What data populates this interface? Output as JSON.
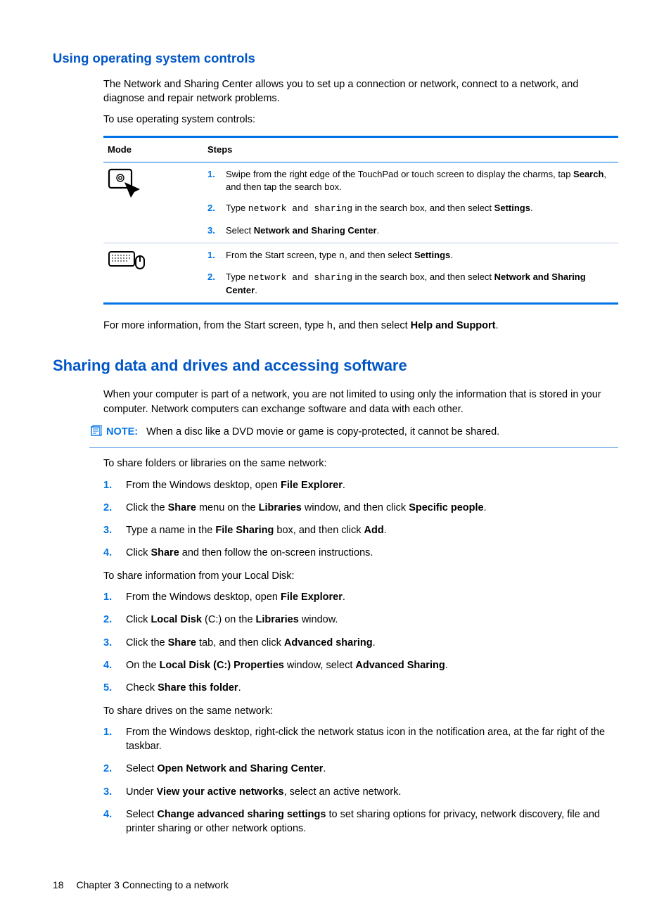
{
  "section1": {
    "title": "Using operating system controls",
    "intro": "The Network and Sharing Center allows you to set up a connection or network, connect to a network, and diagnose and repair network problems.",
    "lead": "To use operating system controls:",
    "table": {
      "h1": "Mode",
      "h2": "Steps",
      "row1": {
        "s1a": "Swipe from the right edge of the TouchPad or touch screen to display the charms, tap ",
        "s1b": "Search",
        "s1c": ", and then tap the search box.",
        "s2a": "Type ",
        "s2mono": "network and sharing",
        "s2b": " in the search box, and then select ",
        "s2c": "Settings",
        "s2d": ".",
        "s3a": "Select ",
        "s3b": "Network and Sharing Center",
        "s3c": "."
      },
      "row2": {
        "s1a": "From the Start screen, type ",
        "s1mono": "n",
        "s1b": ", and then select ",
        "s1c": "Settings",
        "s1d": ".",
        "s2a": "Type ",
        "s2mono": "network and sharing",
        "s2b": " in the search box, and then select ",
        "s2c": "Network and Sharing Center",
        "s2d": "."
      }
    },
    "after_a": "For more information, from the Start screen, type ",
    "after_mono": "h",
    "after_b": ", and then select ",
    "after_c": "Help and Support",
    "after_d": "."
  },
  "section2": {
    "title": "Sharing data and drives and accessing software",
    "intro": "When your computer is part of a network, you are not limited to using only the information that is stored in your computer. Network computers can exchange software and data with each other.",
    "note_label": "NOTE:",
    "note_text": "When a disc like a DVD movie or game is copy-protected, it cannot be shared.",
    "lead1": "To share folders or libraries on the same network:",
    "list1": {
      "s1a": "From the Windows desktop, open ",
      "s1b": "File Explorer",
      "s1c": ".",
      "s2a": "Click the ",
      "s2b": "Share",
      "s2c": " menu on the ",
      "s2d": "Libraries",
      "s2e": " window, and then click ",
      "s2f": "Specific people",
      "s2g": ".",
      "s3a": "Type a name in the ",
      "s3b": "File Sharing",
      "s3c": " box, and then click ",
      "s3d": "Add",
      "s3e": ".",
      "s4a": "Click ",
      "s4b": "Share",
      "s4c": " and then follow the on-screen instructions."
    },
    "lead2": "To share information from your Local Disk:",
    "list2": {
      "s1a": "From the Windows desktop, open ",
      "s1b": "File Explorer",
      "s1c": ".",
      "s2a": "Click ",
      "s2b": "Local Disk",
      "s2c": " (C:) on the ",
      "s2d": "Libraries",
      "s2e": " window.",
      "s3a": "Click the ",
      "s3b": "Share",
      "s3c": " tab, and then click ",
      "s3d": "Advanced sharing",
      "s3e": ".",
      "s4a": "On the ",
      "s4b": "Local Disk (C:) Properties",
      "s4c": " window, select ",
      "s4d": "Advanced Sharing",
      "s4e": ".",
      "s5a": "Check ",
      "s5b": "Share this folder",
      "s5c": "."
    },
    "lead3": "To share drives on the same network:",
    "list3": {
      "s1": "From the Windows desktop, right-click the network status icon in the notification area, at the far right of the taskbar.",
      "s2a": "Select ",
      "s2b": "Open Network and Sharing Center",
      "s2c": ".",
      "s3a": "Under ",
      "s3b": "View your active networks",
      "s3c": ", select an active network.",
      "s4a": "Select ",
      "s4b": "Change advanced sharing settings",
      "s4c": " to set sharing options for privacy, network discovery, file and printer sharing or other network options."
    }
  },
  "footer": {
    "page": "18",
    "chapter": "Chapter 3   Connecting to a network"
  }
}
